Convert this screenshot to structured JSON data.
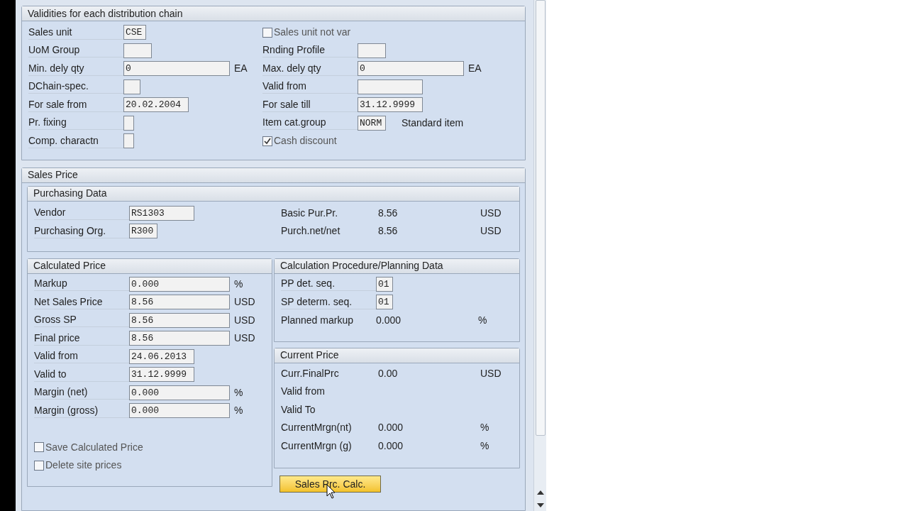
{
  "validities": {
    "title": "Validities for each distribution chain",
    "left": [
      {
        "kind": "field",
        "label": "Sales unit",
        "value": "CSE"
      },
      {
        "kind": "field",
        "label": "UoM Group"
      },
      {
        "kind": "field",
        "label": "Min. dely qty",
        "value": "0",
        "unit": "EA"
      },
      {
        "kind": "field",
        "label": "DChain-spec."
      },
      {
        "kind": "field",
        "label": "For sale from",
        "value": "20.02.2004"
      },
      {
        "kind": "field",
        "label": "Pr. fixing"
      },
      {
        "kind": "field",
        "label": "Comp. charactn"
      }
    ],
    "right": [
      {
        "kind": "checkbox",
        "label": "Sales unit not var",
        "checked": false
      },
      {
        "kind": "field",
        "label": "Rnding Profile"
      },
      {
        "kind": "field",
        "label": "Max. dely qty",
        "value": "0",
        "unit": "EA"
      },
      {
        "kind": "field",
        "label": "Valid from"
      },
      {
        "kind": "field",
        "label": "For sale till",
        "value": "31.12.9999"
      },
      {
        "kind": "field",
        "label": "Item cat.group",
        "value": "NORM",
        "note": "Standard item"
      },
      {
        "kind": "checkbox",
        "label": "Cash discount",
        "checked": true
      }
    ]
  },
  "sales_price": {
    "title": "Sales Price",
    "purchasing": {
      "title": "Purchasing Data",
      "left": [
        {
          "kind": "field",
          "label": "Vendor",
          "value": "RS1303"
        },
        {
          "kind": "field",
          "label": "Purchasing Org.",
          "value": "R300"
        }
      ],
      "right": [
        {
          "kind": "display",
          "label": "Basic Pur.Pr.",
          "value": "8.56",
          "unit": "USD"
        },
        {
          "kind": "display",
          "label": "Purch.net/net",
          "value": "8.56",
          "unit": "USD"
        }
      ]
    },
    "calculated": {
      "title": "Calculated Price",
      "rows": [
        {
          "kind": "field",
          "label": "Markup",
          "value": "0.000",
          "unit": "%"
        },
        {
          "kind": "field",
          "label": "Net Sales Price",
          "value": "8.56",
          "unit": "USD"
        },
        {
          "kind": "field",
          "label": "Gross SP",
          "value": "8.56",
          "unit": "USD"
        },
        {
          "kind": "field",
          "label": "Final price",
          "value": "8.56",
          "unit": "USD"
        },
        {
          "kind": "field",
          "label": "Valid from",
          "value": "24.06.2013"
        },
        {
          "kind": "field",
          "label": "Valid to",
          "value": "31.12.9999"
        },
        {
          "kind": "field",
          "label": "Margin (net)",
          "value": "0.000",
          "unit": "%"
        },
        {
          "kind": "field",
          "label": "Margin (gross)",
          "value": "0.000",
          "unit": "%"
        }
      ],
      "checkboxes": [
        {
          "kind": "checkbox",
          "label": "Save Calculated Price",
          "checked": false
        },
        {
          "kind": "checkbox",
          "label": "Delete site prices",
          "checked": false
        }
      ]
    },
    "procedure": {
      "title": "Calculation Procedure/Planning Data",
      "rows": [
        {
          "kind": "field",
          "label": "PP det. seq.",
          "value": "01"
        },
        {
          "kind": "field",
          "label": "SP determ. seq.",
          "value": "01"
        },
        {
          "kind": "display",
          "label": "Planned markup",
          "value": "0.000",
          "unit": "%"
        }
      ]
    },
    "current": {
      "title": "Current Price",
      "rows": [
        {
          "kind": "display",
          "label": "Curr.FinalPrc",
          "value": "0.00",
          "unit": "USD"
        },
        {
          "kind": "display",
          "label": "Valid from"
        },
        {
          "kind": "display",
          "label": "Valid To"
        },
        {
          "kind": "display",
          "label": "CurrentMrgn(nt)",
          "value": "0.000",
          "unit": "%"
        },
        {
          "kind": "display",
          "label": "CurrentMrgn (g)",
          "value": "0.000",
          "unit": "%"
        }
      ]
    },
    "button": "Sales Prc. Calc."
  }
}
